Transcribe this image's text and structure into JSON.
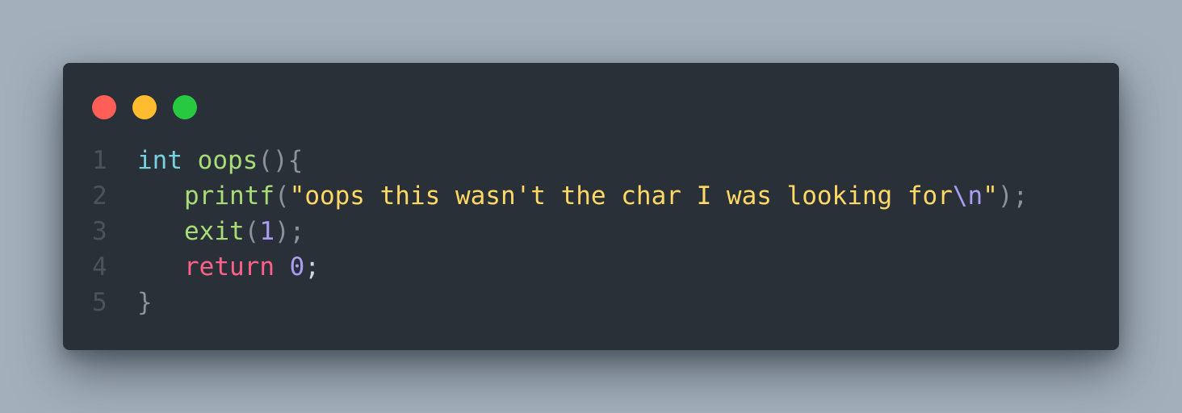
{
  "window": {
    "controls": {
      "close_color": "#ff5f57",
      "minimize_color": "#febc2e",
      "zoom_color": "#28c840"
    }
  },
  "code": {
    "language": "c",
    "lines": [
      {
        "number": "1",
        "tokens": [
          {
            "text": "int",
            "kind": "type"
          },
          {
            "text": " ",
            "kind": "space"
          },
          {
            "text": "oops",
            "kind": "function"
          },
          {
            "text": "(){",
            "kind": "punctuation"
          }
        ]
      },
      {
        "number": "2",
        "tokens": [
          {
            "text": "printf",
            "kind": "function"
          },
          {
            "text": "(",
            "kind": "punctuation"
          },
          {
            "text": "\"oops this wasn't the char I was looking for",
            "kind": "string"
          },
          {
            "text": "\\n",
            "kind": "escape"
          },
          {
            "text": "\"",
            "kind": "string"
          },
          {
            "text": ");",
            "kind": "punctuation"
          }
        ]
      },
      {
        "number": "3",
        "tokens": [
          {
            "text": "exit",
            "kind": "function"
          },
          {
            "text": "(",
            "kind": "punctuation"
          },
          {
            "text": "1",
            "kind": "number"
          },
          {
            "text": ");",
            "kind": "punctuation"
          }
        ]
      },
      {
        "number": "4",
        "tokens": [
          {
            "text": "return",
            "kind": "keyword"
          },
          {
            "text": " ",
            "kind": "space"
          },
          {
            "text": "0",
            "kind": "number"
          },
          {
            "text": ";",
            "kind": "punctuation"
          }
        ]
      },
      {
        "number": "5",
        "tokens": [
          {
            "text": "}",
            "kind": "punctuation"
          }
        ]
      }
    ]
  }
}
